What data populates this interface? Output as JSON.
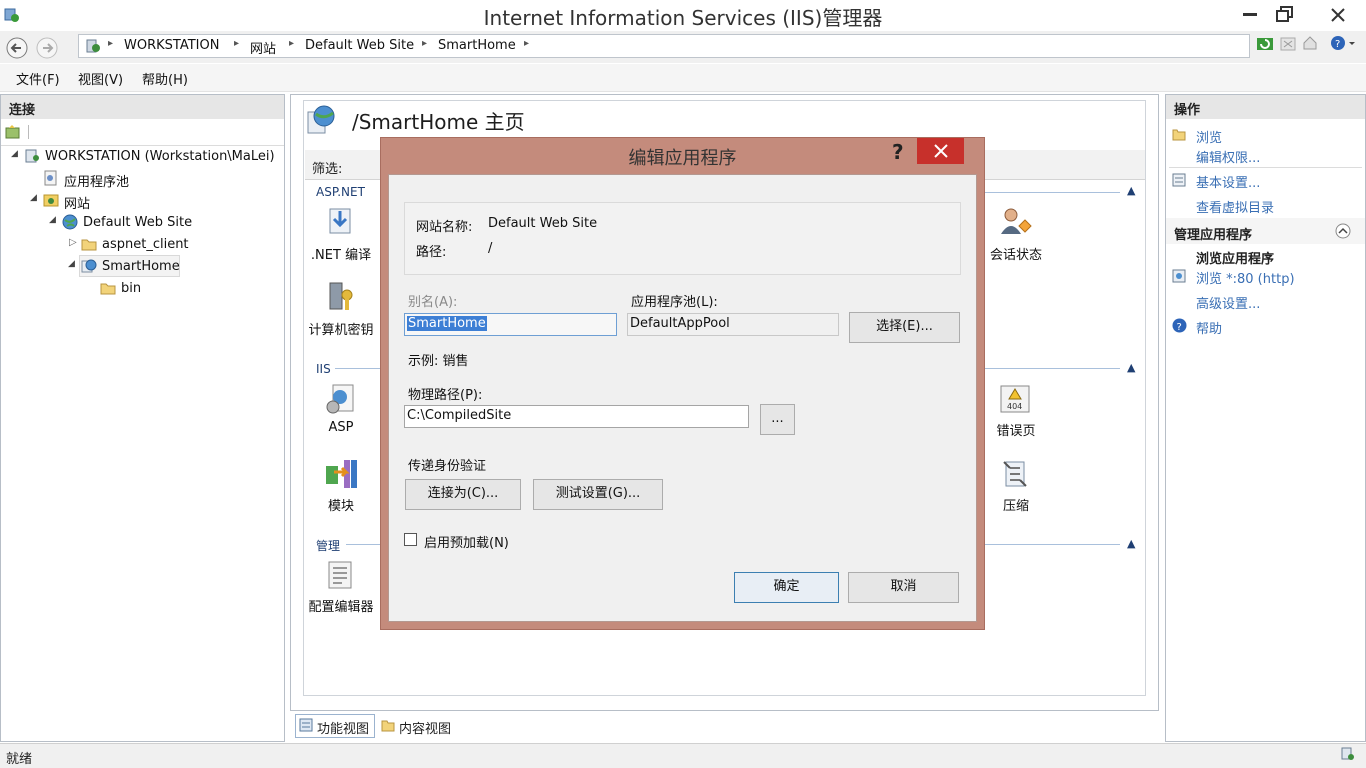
{
  "window": {
    "title": "Internet Information Services (IIS)管理器"
  },
  "address": {
    "crumbs": [
      "WORKSTATION",
      "网站",
      "Default Web Site",
      "SmartHome"
    ]
  },
  "menu": [
    "文件(F)",
    "视图(V)",
    "帮助(H)"
  ],
  "connections": {
    "header": "连接",
    "tree": [
      {
        "label": "WORKSTATION (Workstation\\MaLei)",
        "level": 0
      },
      {
        "label": "应用程序池",
        "level": 1
      },
      {
        "label": "网站",
        "level": 1
      },
      {
        "label": "Default Web Site",
        "level": 2
      },
      {
        "label": "aspnet_client",
        "level": 3
      },
      {
        "label": "SmartHome",
        "level": 3,
        "selected": true
      },
      {
        "label": "bin",
        "level": 4
      }
    ]
  },
  "center": {
    "page_title": "/SmartHome 主页",
    "filter_label": "筛选:",
    "groups": {
      "aspnet": "ASP.NET",
      "iis": "IIS",
      "manage": "管理"
    },
    "features": {
      "net_compile": ".NET 编译",
      "machine_key": "计算机密钥",
      "session_state": "会话状态",
      "asp": "ASP",
      "error_pages": "错误页",
      "modules": "模块",
      "compression": "压缩",
      "config_editor": "配置编辑器"
    },
    "tabs": {
      "feature_view": "功能视图",
      "content_view": "内容视图"
    }
  },
  "actions": {
    "header": "操作",
    "browse": "浏览",
    "edit_permissions": "编辑权限...",
    "basic_settings": "基本设置...",
    "view_virtual_dirs": "查看虚拟目录",
    "manage_app_header": "管理应用程序",
    "browse_app_header": "浏览应用程序",
    "browse_http": "浏览 *:80 (http)",
    "advanced_settings": "高级设置...",
    "help": "帮助"
  },
  "dialog": {
    "title": "编辑应用程序",
    "help_glyph": "?",
    "site_name_label": "网站名称:",
    "site_name_value": "Default Web Site",
    "path_label": "路径:",
    "path_value": "/",
    "alias_label": "别名(A):",
    "alias_value": "SmartHome",
    "app_pool_label": "应用程序池(L):",
    "app_pool_value": "DefaultAppPool",
    "select_button": "选择(E)...",
    "example_text": "示例: 销售",
    "physical_path_label": "物理路径(P):",
    "physical_path_value": "C:\\CompiledSite",
    "browse_button": "...",
    "pass_auth_label": "传递身份验证",
    "connect_as_button": "连接为(C)...",
    "test_settings_button": "测试设置(G)...",
    "preload_label": "启用预加载(N)",
    "preload_checked": false,
    "ok_button": "确定",
    "cancel_button": "取消"
  },
  "status": {
    "text": "就绪"
  },
  "colors": {
    "dialog_frame": "#c48b7c",
    "close_red": "#c7302b",
    "link_blue": "#3a6fb4"
  }
}
